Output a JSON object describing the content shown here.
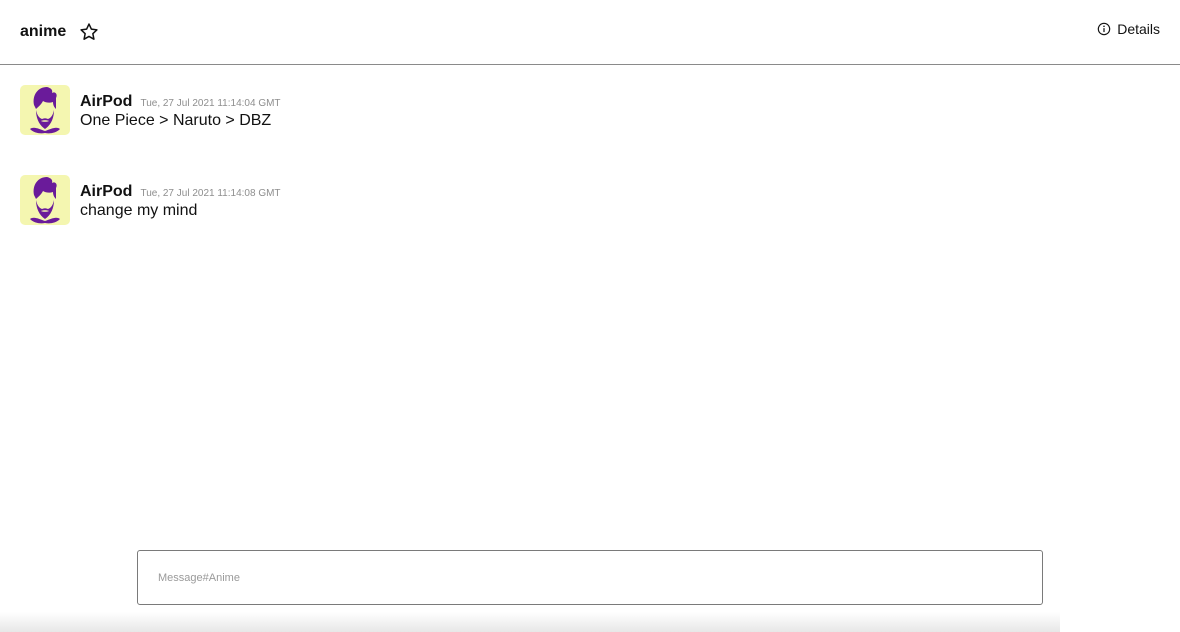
{
  "header": {
    "channel_name": "anime",
    "details_label": "Details"
  },
  "messages": [
    {
      "author": "AirPod",
      "timestamp": "Tue, 27 Jul 2021 11:14:04 GMT",
      "text": "One Piece > Naruto > DBZ"
    },
    {
      "author": "AirPod",
      "timestamp": "Tue, 27 Jul 2021 11:14:08 GMT",
      "text": "change my mind"
    }
  ],
  "composer": {
    "placeholder": "Message#Anime",
    "value": ""
  },
  "colors": {
    "avatar_bg": "#f4f6b0",
    "avatar_figure": "#6a1b9a"
  }
}
